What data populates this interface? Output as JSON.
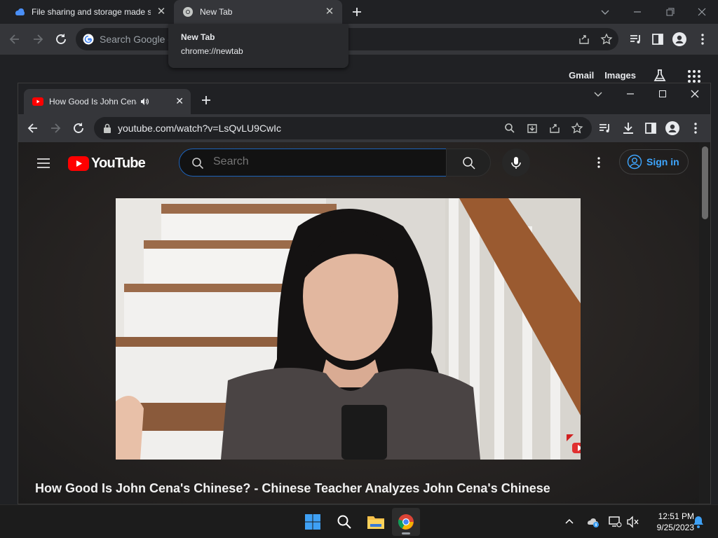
{
  "outer_browser": {
    "tabs": [
      {
        "title": "File sharing and storage made simple",
        "active": false
      },
      {
        "title": "New Tab",
        "active": true
      }
    ],
    "omnibox_placeholder": "Search Google or type a URL",
    "tooltip": {
      "title": "New Tab",
      "url": "chrome://newtab"
    },
    "ntp_links": {
      "gmail": "Gmail",
      "images": "Images"
    }
  },
  "inner_browser": {
    "tab": {
      "title": "How Good Is John Cena's Chinese? - Chinese Teacher Analyzes John Cena's Chinese"
    },
    "url": "youtube.com/watch?v=LsQvLU9CwIc"
  },
  "youtube": {
    "logo_text": "YouTube",
    "search_placeholder": "Search",
    "sign_in_label": "Sign in",
    "video_title": "How Good Is John Cena's Chinese? - Chinese Teacher Analyzes John Cena's Chinese"
  },
  "taskbar": {
    "time": "12:51 PM",
    "date": "9/25/2023"
  },
  "colors": {
    "chrome_dark": "#202124",
    "chrome_toolbar": "#35363a",
    "youtube_red": "#ff0000",
    "link_blue": "#3ea6ff"
  }
}
